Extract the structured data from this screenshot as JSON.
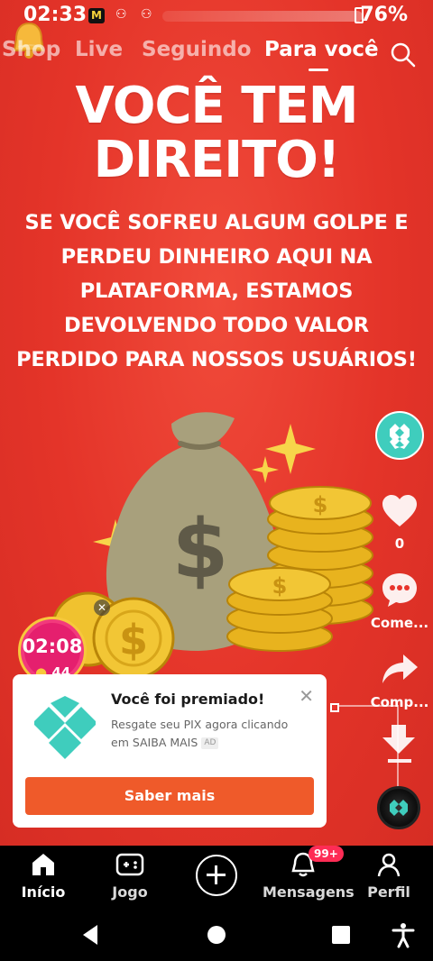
{
  "status_bar": {
    "time": "02:33",
    "app_badge": "M",
    "battery": "76%"
  },
  "top_nav": {
    "tabs": [
      {
        "label": "Shop"
      },
      {
        "label": "Live"
      },
      {
        "label": "Seguindo"
      },
      {
        "label": "Para você"
      }
    ],
    "active_tab": "Para você"
  },
  "post": {
    "headline_line1": "VOCÊ TEM",
    "headline_line2": "DIREITO!",
    "subtext_lines": [
      "SE VOCÊ SOFREU ALGUM GOLPE E",
      "PERDEU DINHEIRO AQUI NA",
      "PLATAFORMA, ESTAMOS",
      "DEVOLVENDO TODO VALOR",
      "PERDIDO PARA NOSSOS USUÁRIOS!"
    ]
  },
  "side_rail": {
    "like_count": "0",
    "comment_label": "Come...",
    "share_label": "Comp..."
  },
  "timer": {
    "time": "02:08",
    "coins": "44"
  },
  "ad": {
    "title": "Você foi premiado!",
    "description": "Resgate seu PIX agora clicando em SAIBA MAIS",
    "tag": "AD",
    "cta": "Saber mais"
  },
  "bottom_tabs": {
    "home": "Início",
    "game": "Jogo",
    "messages": "Mensagens",
    "messages_badge": "99+",
    "profile": "Perfil"
  },
  "colors": {
    "background": "#e8332c",
    "cta": "#ef5a2a",
    "badge": "#fe2c55",
    "pix_teal": "#3fcdbd"
  }
}
